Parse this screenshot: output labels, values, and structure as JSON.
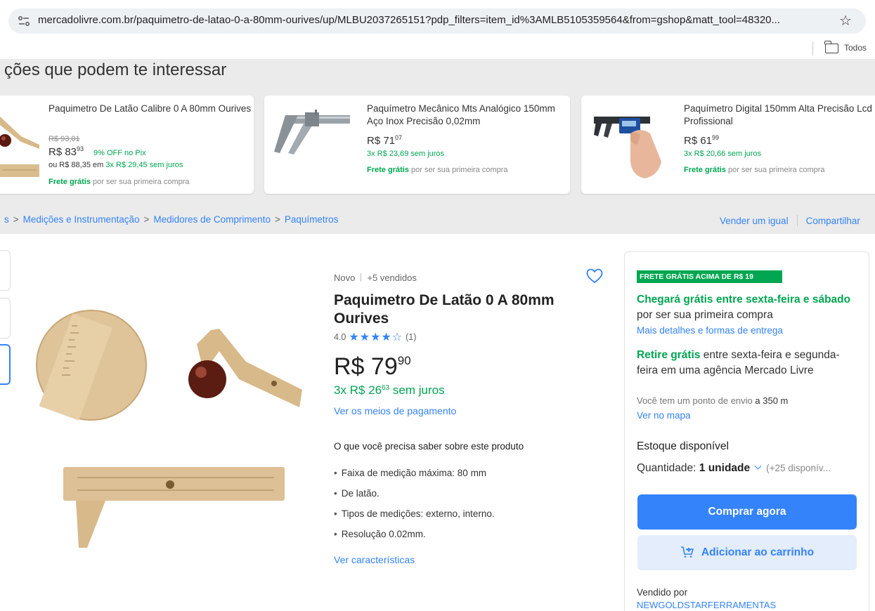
{
  "browser": {
    "url": "mercadolivre.com.br/paquimetro-de-latao-0-a-80mm-ourives/up/MLBU2037265151?pdp_filters=item_id%3AMLB5105359564&from=gshop&matt_tool=48320...",
    "bookmarks_label": "Todos"
  },
  "recommendations": {
    "title": "ções que podem te interessar",
    "cards": [
      {
        "title": "Paquimetro De Latão Calibre 0 A 80mm Ourives",
        "old_price": "R$ 93,01",
        "price_int": "R$ 83",
        "price_cents": "93",
        "discount": "9% OFF no Pix",
        "installments_prefix": "ou R$ 88,35 em",
        "installments_green": "3x R$ 29,45 sem juros",
        "frete_bold": "Frete grátis",
        "frete_rest": "por ser sua primeira compra"
      },
      {
        "title": "Paquímetro Mecânico Mts Analógico 150mm Aço Inox Precisão 0,02mm",
        "price_int": "R$ 71",
        "price_cents": "07",
        "installments_green": "3x R$ 23,69 sem juros",
        "frete_bold": "Frete grátis",
        "frete_rest": "por ser sua primeira compra"
      },
      {
        "title": "Paquímetro Digital 150mm Alta Precisão Lcd Profissional",
        "price_int": "R$ 61",
        "price_cents": "99",
        "installments_green": "3x R$ 20,66 sem juros",
        "frete_bold": "Frete grátis",
        "frete_rest": "por ser sua primeira compra"
      }
    ]
  },
  "breadcrumb": {
    "lead": "s",
    "items": [
      "Medições e Instrumentação",
      "Medidores de Comprimento",
      "Paquímetros"
    ]
  },
  "actions": {
    "sell": "Vender um igual",
    "share": "Compartilhar"
  },
  "product": {
    "condition": "Novo",
    "sold": "+5 vendidos",
    "title": "Paquimetro De Latão 0 A 80mm Ourives",
    "rating": "4.0",
    "stars": "★★★★☆",
    "reviews": "(1)",
    "price_int": "R$ 79",
    "price_cents": "90",
    "installments_pre": "3x R$ 26",
    "installments_cents": "63",
    "installments_post": "sem juros",
    "payment_link": "Ver os meios de pagamento",
    "know_title": "O que você precisa saber sobre este produto",
    "features": [
      "Faixa de medição máxima: 80 mm",
      "De latão.",
      "Tipos de medições: externo, interno.",
      "Resolução 0.02mm."
    ],
    "char_link": "Ver características"
  },
  "buybox": {
    "badge": "FRETE GRÁTIS ACIMA DE R$ 19",
    "ship1_green": "Chegará grátis entre sexta-feira e sábado",
    "ship1_rest": "por ser sua primeira compra",
    "ship1_link": "Mais detalhes e formas de entrega",
    "ship2_green": "Retire grátis",
    "ship2_rest": "entre sexta-feira e segunda-feira em uma agência Mercado Livre",
    "pickup_text": "Você tem um ponto de envio",
    "pickup_dist": "a 350 m",
    "map_link": "Ver no mapa",
    "stock": "Estoque disponível",
    "qty_label": "Quantidade:",
    "qty_value": "1 unidade",
    "qty_avail": "(+25 disponív...",
    "buy_button": "Comprar agora",
    "cart_button": "Adicionar ao carrinho",
    "sold_by": "Vendido por",
    "seller": "NEWGOLDSTARFERRAMENTAS"
  }
}
